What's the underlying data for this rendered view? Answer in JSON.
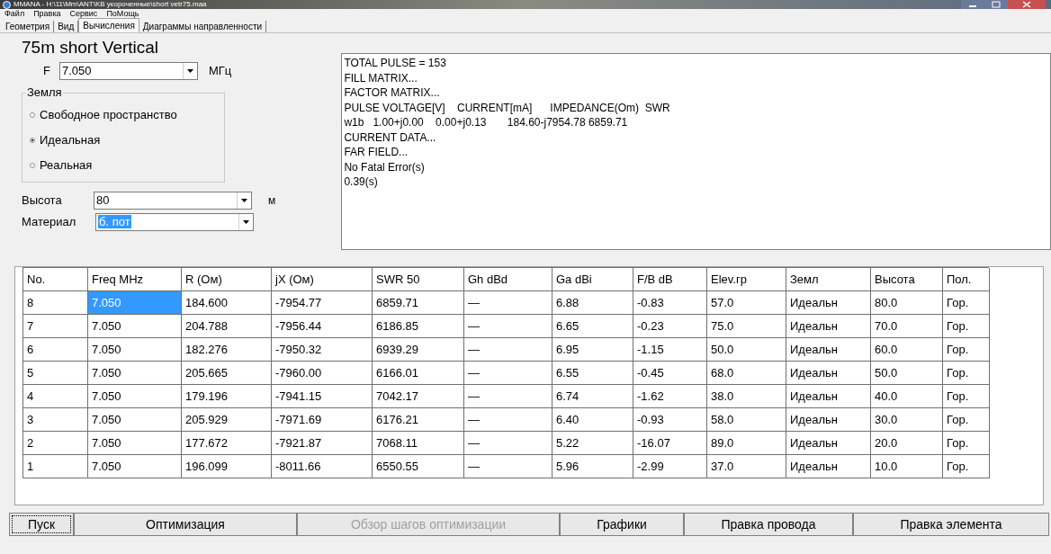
{
  "window": {
    "title": "MMANA - H:\\11\\Mm\\ANT\\KB укороченные\\short vetr75.maa"
  },
  "menu": [
    "Файл",
    "Правка",
    "Сервис",
    "ПоМощь"
  ],
  "tabs": [
    {
      "label": "Геометрия",
      "selected": false
    },
    {
      "label": "Вид",
      "selected": false
    },
    {
      "label": "Вычисления",
      "selected": true
    },
    {
      "label": "Диаграммы направленности",
      "selected": false
    }
  ],
  "heading": "75m short Vertical",
  "frequency": {
    "label": "F",
    "value": "7.050",
    "unit": "МГц"
  },
  "ground": {
    "legend": "Земля",
    "options": [
      {
        "label": "Свободное пространство",
        "selected": false
      },
      {
        "label": "Идеальная",
        "selected": true
      },
      {
        "label": "Реальная",
        "selected": false
      }
    ]
  },
  "height": {
    "label": "Высота",
    "value": "80",
    "unit": "м"
  },
  "material": {
    "label": "Материал",
    "value": "б. пот"
  },
  "log": [
    "TOTAL PULSE = 153",
    "FILL MATRIX...",
    "FACTOR MATRIX...",
    "PULSE VOLTAGE[V]    CURRENT[mA]      IMPEDANCE(Om)  SWR",
    "w1b   1.00+j0.00    0.00+j0.13       184.60-j7954.78 6859.71",
    "CURRENT DATA...",
    "FAR FIELD...",
    "No Fatal Error(s)",
    "0.39(s)"
  ],
  "table": {
    "columns": [
      "No.",
      "Freq MHz",
      "R (Ом)",
      "jX (Ом)",
      "SWR 50",
      "Gh dBd",
      "Ga dBi",
      "F/B dB",
      "Elev.гр",
      "Земл",
      "Высота",
      "Пол."
    ],
    "rows": [
      {
        "selected": true,
        "cells": [
          "8",
          "7.050",
          "184.600",
          "-7954.77",
          "6859.71",
          "—",
          "6.88",
          "-0.83",
          "57.0",
          "Идеальн",
          "80.0",
          "Гор."
        ]
      },
      {
        "selected": false,
        "cells": [
          "7",
          "7.050",
          "204.788",
          "-7956.44",
          "6186.85",
          "—",
          "6.65",
          "-0.23",
          "75.0",
          "Идеальн",
          "70.0",
          "Гор."
        ]
      },
      {
        "selected": false,
        "cells": [
          "6",
          "7.050",
          "182.276",
          "-7950.32",
          "6939.29",
          "—",
          "6.95",
          "-1.15",
          "50.0",
          "Идеальн",
          "60.0",
          "Гор."
        ]
      },
      {
        "selected": false,
        "cells": [
          "5",
          "7.050",
          "205.665",
          "-7960.00",
          "6166.01",
          "—",
          "6.55",
          "-0.45",
          "68.0",
          "Идеальн",
          "50.0",
          "Гор."
        ]
      },
      {
        "selected": false,
        "cells": [
          "4",
          "7.050",
          "179.196",
          "-7941.15",
          "7042.17",
          "—",
          "6.74",
          "-1.62",
          "38.0",
          "Идеальн",
          "40.0",
          "Гор."
        ]
      },
      {
        "selected": false,
        "cells": [
          "3",
          "7.050",
          "205.929",
          "-7971.69",
          "6176.21",
          "—",
          "6.40",
          "-0.93",
          "58.0",
          "Идеальн",
          "30.0",
          "Гор."
        ]
      },
      {
        "selected": false,
        "cells": [
          "2",
          "7.050",
          "177.672",
          "-7921.87",
          "7068.11",
          "—",
          "5.22",
          "-16.07",
          "89.0",
          "Идеальн",
          "20.0",
          "Гор."
        ]
      },
      {
        "selected": false,
        "cells": [
          "1",
          "7.050",
          "196.099",
          "-8011.66",
          "6550.55",
          "—",
          "5.96",
          "-2.99",
          "37.0",
          "Идеальн",
          "10.0",
          "Гор."
        ]
      }
    ]
  },
  "buttons": [
    {
      "label": "Пуск",
      "disabled": false
    },
    {
      "label": "Оптимизация",
      "disabled": false
    },
    {
      "label": "Обзор шагов оптимизации",
      "disabled": true
    },
    {
      "label": "Графики",
      "disabled": false
    },
    {
      "label": "Правка провода",
      "disabled": false
    },
    {
      "label": "Правка элемента",
      "disabled": false
    }
  ]
}
